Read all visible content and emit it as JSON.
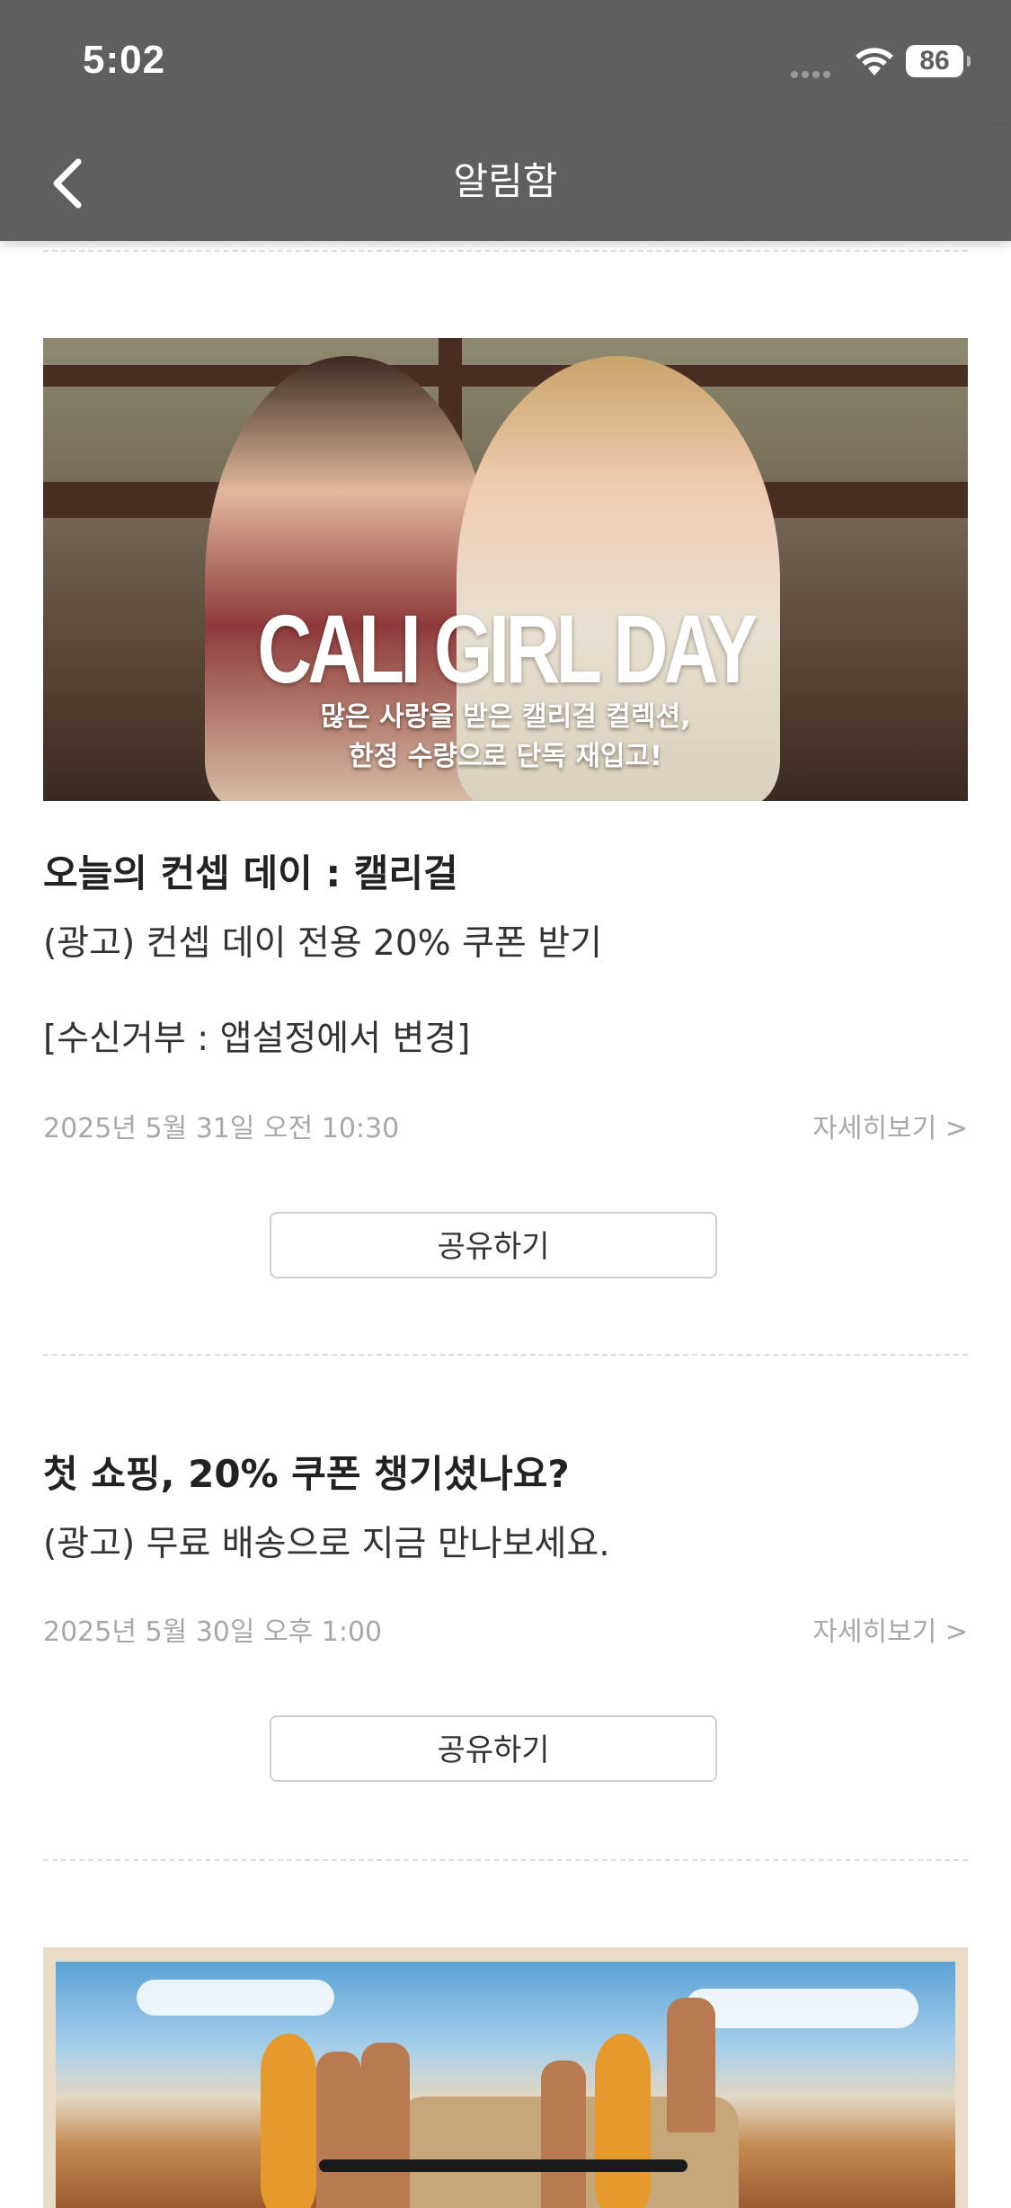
{
  "status_bar": {
    "time": "5:02",
    "battery": "86"
  },
  "nav": {
    "title": "알림함"
  },
  "notifications": [
    {
      "banner": {
        "headline": "CALI GIRL DAY",
        "sub_line1": "많은 사랑을 받은 캘리걸 컬렉션,",
        "sub_line2": "한정 수량으로 단독 재입고!"
      },
      "title": "오늘의 컨셉 데이 : 캘리걸",
      "body": "(광고) 컨셉 데이 전용 20% 쿠폰 받기",
      "optout": "[수신거부 : 앱설정에서 변경]",
      "date": "2025년 5월 31일 오전 10:30",
      "detail_label": "자세히보기 >",
      "share_label": "공유하기"
    },
    {
      "title": "첫 쇼핑, 20% 쿠폰 챙기셨나요?",
      "body": "(광고) 무료 배송으로 지금 만나보세요.",
      "date": "2025년 5월 30일 오후 1:00",
      "detail_label": "자세히보기 >",
      "share_label": "공유하기"
    }
  ],
  "colors": {
    "header_bg": "#5f5f5f",
    "meta_text": "#a8a8a8",
    "divider": "#dcdcdc"
  }
}
